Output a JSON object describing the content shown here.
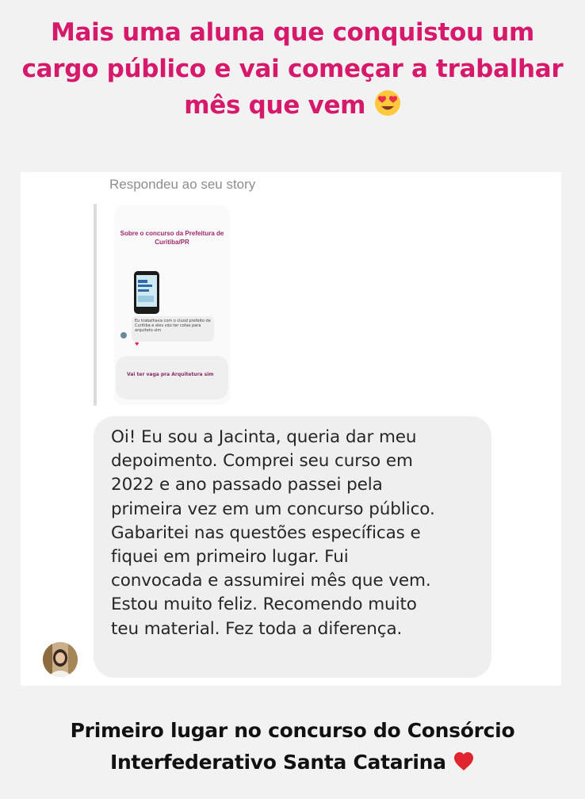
{
  "header": {
    "headline": "Mais uma aluna que conquistou um cargo público e vai começar a trabalhar mês que vem",
    "emoji": "smiling-face-with-heart-eyes-icon"
  },
  "message": {
    "story_label": "Respondeu ao seu story",
    "story_preview": {
      "title": "Sobre o concurso da Prefeitura de Curitiba/PR",
      "bubble_text": "Eu trabalhava com o cluod prefeito de Curitiba e eles vão ter cotas para arquiteto sim",
      "reply_text": "Vai ter vaga pra Arquitetura sim"
    },
    "bubble_text": "Oi! Eu sou a Jacinta, queria dar meu\ndepoimento. Comprei seu curso em\n2022 e ano passado passei pela\nprimeira vez em um concurso público.\nGabaritei nas questões específicas e\nfiquei em primeiro lugar. Fui\nconvocada e assumirei mês que vem.\nEstou muito feliz. Recomendo muito\nteu material. Fez toda a diferença."
  },
  "footer": {
    "caption": "Primeiro lugar no concurso do Consórcio Interfederativo Santa Catarina",
    "emoji": "red-heart-icon"
  },
  "colors": {
    "headline": "#d6196b",
    "background": "#f2f2f2",
    "bubble": "#efefef"
  }
}
